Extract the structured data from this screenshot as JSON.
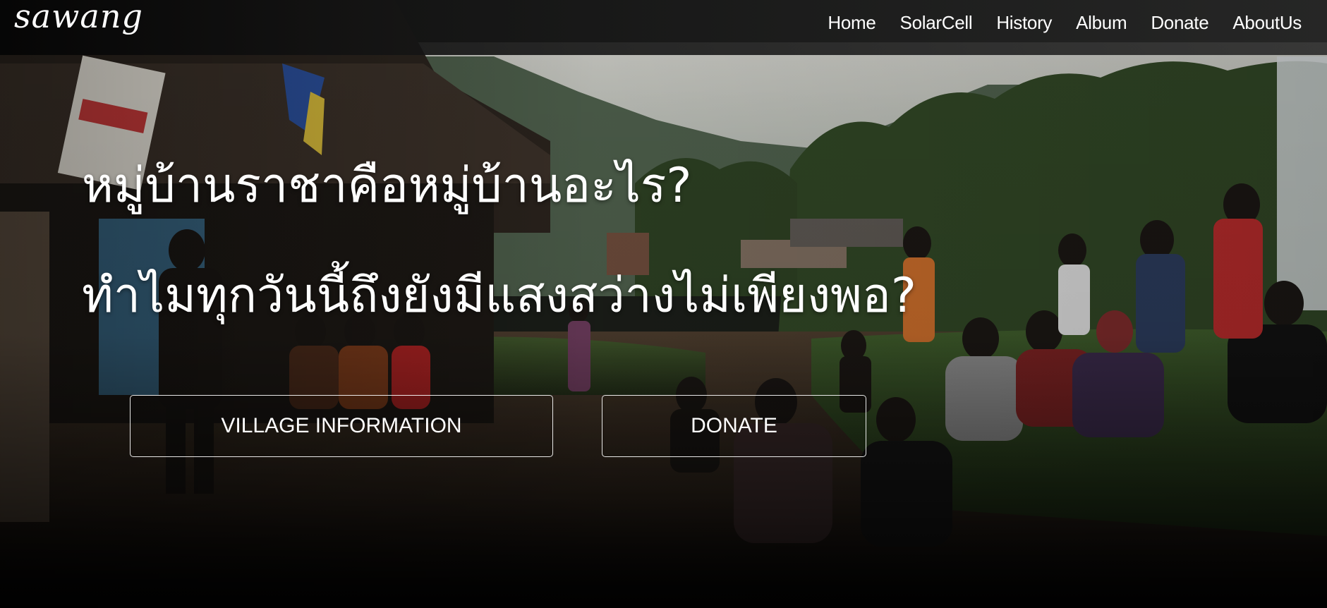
{
  "brand": {
    "logo_text": "sawang"
  },
  "nav": {
    "items": [
      {
        "label": "Home"
      },
      {
        "label": "SolarCell"
      },
      {
        "label": "History"
      },
      {
        "label": "Album"
      },
      {
        "label": "Donate"
      },
      {
        "label": "AboutUs"
      }
    ]
  },
  "hero": {
    "headline_line1": "หมู่บ้านราชาคือหมู่บ้านอะไร?",
    "headline_line2": "ทำไมทุกวันนี้ถึงยังมีแสงสว่างไม่เพียงพอ?",
    "buttons": {
      "village_info": "VILLAGE INFORMATION",
      "donate": "DONATE"
    },
    "background_icon": "village-photo"
  },
  "colors": {
    "text": "#ffffff",
    "navbar": "#232323",
    "button_border": "#ffffff"
  }
}
